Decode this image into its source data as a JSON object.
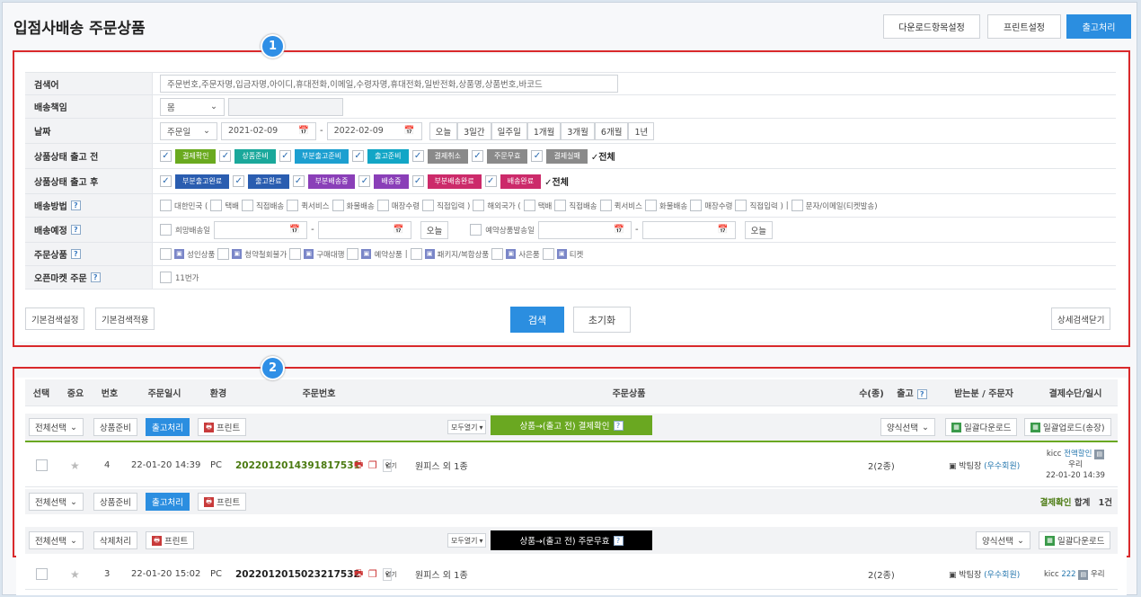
{
  "header": {
    "title": "입점사배송 주문상품",
    "buttons": [
      "다운로드항목설정",
      "프린트설정",
      "출고처리"
    ]
  },
  "badges": [
    "1",
    "2"
  ],
  "search": {
    "keyword": {
      "label": "검색어",
      "placeholder": "주문번호,주문자명,입금자명,아이디,휴대전화,이메일,수령자명,휴대전화,일반전화,상품명,상품번호,바코드"
    },
    "delivery_owner": {
      "label": "배송책임",
      "select": "몸"
    },
    "date": {
      "label": "날짜",
      "select": "주문일",
      "from": "2021-02-09",
      "to": "2022-02-09",
      "sep": "-",
      "presets": [
        "오늘",
        "3일간",
        "일주일",
        "1개월",
        "3개월",
        "6개월",
        "1년"
      ]
    },
    "status_before": {
      "label": "상품상태 출고 전",
      "tags": [
        {
          "text": "결제확인",
          "color": "#6aaa1f"
        },
        {
          "text": "상품준비",
          "color": "#1aa89b"
        },
        {
          "text": "부분출고준비",
          "color": "#1c9fd0"
        },
        {
          "text": "출고준비",
          "color": "#12a6c6"
        },
        {
          "text": "결제취소",
          "color": "#8a8a8a"
        },
        {
          "text": "주문무효",
          "color": "#8a8a8a"
        },
        {
          "text": "결제실패",
          "color": "#8a8a8a"
        }
      ],
      "all": "전체"
    },
    "status_after": {
      "label": "상품상태 출고 후",
      "tags": [
        {
          "text": "부분출고완료",
          "color": "#2a5db0"
        },
        {
          "text": "출고완료",
          "color": "#2a5db0"
        },
        {
          "text": "부분배송중",
          "color": "#8a3fb8"
        },
        {
          "text": "배송중",
          "color": "#8a3fb8"
        },
        {
          "text": "부분배송완료",
          "color": "#cc2a6a"
        },
        {
          "text": "배송완료",
          "color": "#cc2a6a"
        }
      ],
      "all": "전체"
    },
    "method": {
      "label": "배송방법",
      "items": [
        "대한민국 (",
        "택배",
        "직접배송",
        "퀵서비스",
        "화물배송",
        "매장수령",
        "직접입력 )",
        "해외국가 (",
        "택배",
        "직접배송",
        "퀵서비스",
        "화물배송",
        "매장수령",
        "직접입력 )",
        "|",
        "문자/이메일(티켓발송)"
      ]
    },
    "planned": {
      "label": "배송예정",
      "item1": "희망배송일",
      "item2": "예약상품발송일",
      "today": "오늘",
      "sep": "-"
    },
    "product": {
      "label": "주문상품",
      "items": [
        "성인상품",
        "청약철회불가",
        "구매대행",
        "예약상품",
        "|",
        "패키지/복합상품",
        "사은품",
        "티켓"
      ]
    },
    "openmarket": {
      "label": "오픈마켓 주문",
      "item": "11번가"
    },
    "buttons": {
      "basic_set": "기본검색설정",
      "basic_apply": "기본검색적용",
      "search": "검색",
      "reset": "초기화",
      "detail_close": "상세검색닫기"
    }
  },
  "table": {
    "headers": [
      "선택",
      "중요",
      "번호",
      "주문일시",
      "환경",
      "주문번호",
      "주문상품",
      "수(종)",
      "출고",
      "받는분 / 주문자",
      "결제수단/일시"
    ],
    "bar_buttons": {
      "select_all": "전체선택",
      "prepare": "상품준비",
      "ship": "출고처리",
      "print": "프린트",
      "delete": "삭제처리",
      "open_all": "모두열기",
      "form_select": "양식선택",
      "bulk_download": "일괄다운로드",
      "bulk_upload": "일괄업로드(송장)"
    },
    "group1_title": "상품→(출고 전) 결제확인",
    "group2_title": "상품→(출고 전) 주문무효",
    "rows": [
      {
        "no": "4",
        "date": "22-01-20 14:39",
        "env": "PC",
        "order_no": "2022012014391817531",
        "product": "원피스 외 1종",
        "count": "2(2종)",
        "receiver": "박팀장",
        "member": "(우수회원)",
        "pay_method": "kicc",
        "pay_link": "전액할인",
        "pay_extra": "우리",
        "pay_date": "22-01-20 14:39"
      },
      {
        "no": "3",
        "date": "22-01-20 15:02",
        "env": "PC",
        "order_no": "2022012015023217532",
        "product": "원피스 외 1종",
        "count": "2(2종)",
        "receiver": "박팀장",
        "member": "(우수회원)",
        "pay_method": "kicc",
        "pay_link": "222",
        "pay_extra": "우리"
      }
    ],
    "summary": {
      "status": "결제확인",
      "label": "합계",
      "count": "1건"
    },
    "open_label": "열기"
  }
}
